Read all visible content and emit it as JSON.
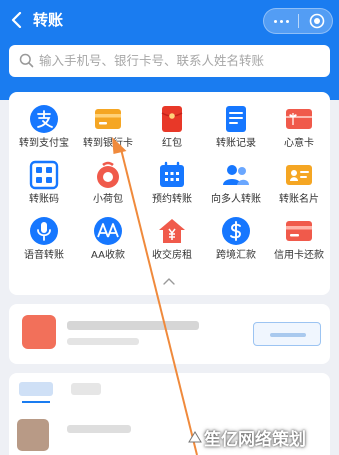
{
  "header": {
    "title": "转账",
    "back_icon": "chevron-left-icon",
    "more_icon": "more-dots-icon",
    "close_icon": "target-close-icon",
    "color": "#1a7cf0"
  },
  "search": {
    "placeholder": "输入手机号、银行卡号、联系人姓名转账",
    "icon": "search-icon"
  },
  "grid": {
    "items": [
      {
        "label": "转到支付宝",
        "icon": "alipay-icon",
        "color": "#1677ff"
      },
      {
        "label": "转到银行卡",
        "icon": "bank-card-icon",
        "color": "#f5a623"
      },
      {
        "label": "红包",
        "icon": "red-packet-icon",
        "color": "#e83828"
      },
      {
        "label": "转账记录",
        "icon": "transfer-record-icon",
        "color": "#1677ff"
      },
      {
        "label": "心意卡",
        "icon": "gift-card-icon",
        "color": "#f05a4b"
      },
      {
        "label": "转账码",
        "icon": "qr-code-icon",
        "color": "#1677ff"
      },
      {
        "label": "小荷包",
        "icon": "purse-icon",
        "color": "#f05a4b"
      },
      {
        "label": "预约转账",
        "icon": "calendar-icon",
        "color": "#1677ff"
      },
      {
        "label": "向多人转账",
        "icon": "group-icon",
        "color": "#1677ff"
      },
      {
        "label": "转账名片",
        "icon": "name-card-icon",
        "color": "#f5a623"
      },
      {
        "label": "语音转账",
        "icon": "microphone-icon",
        "color": "#1677ff"
      },
      {
        "label": "AA收款",
        "icon": "aa-icon",
        "color": "#1677ff"
      },
      {
        "label": "收交房租",
        "icon": "house-rent-icon",
        "color": "#f05a4b"
      },
      {
        "label": "跨境汇款",
        "icon": "dollar-icon",
        "color": "#1677ff"
      },
      {
        "label": "信用卡还款",
        "icon": "credit-card-icon",
        "color": "#f05a4b"
      }
    ],
    "collapse_icon": "chevron-up-icon"
  },
  "watermark": {
    "text": "笙亿网络策划",
    "logo": "watermark-logo-icon"
  },
  "annotation": {
    "arrow_color": "#f08a3c",
    "arrow_icon": "annotation-arrow-icon"
  }
}
